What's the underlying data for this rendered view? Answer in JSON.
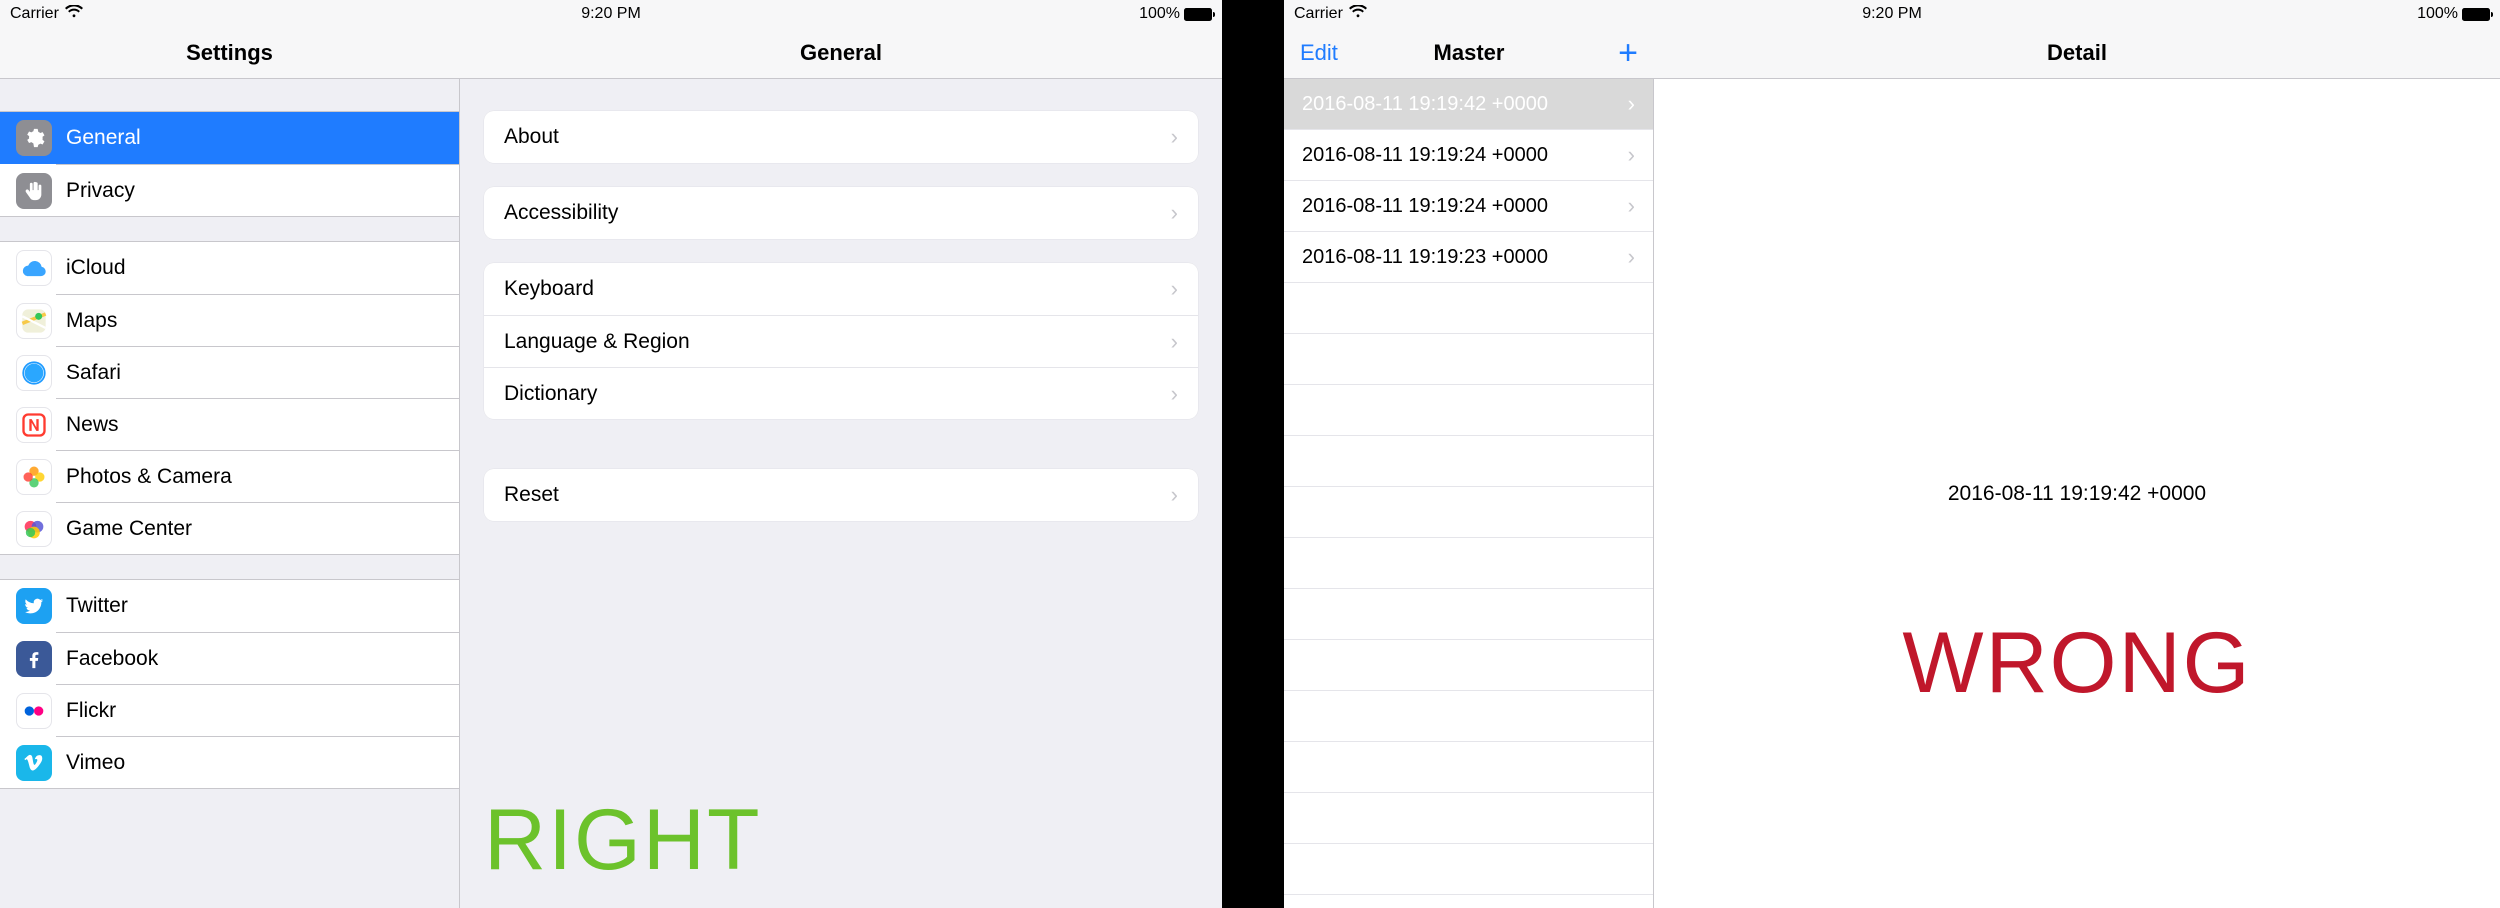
{
  "status": {
    "carrier": "Carrier",
    "time": "9:20 PM",
    "battery_pct": "100%"
  },
  "left": {
    "sidebar_title": "Settings",
    "detail_title": "General",
    "overlay": "RIGHT",
    "groups": [
      {
        "items": [
          {
            "icon": "gear-icon",
            "bg": "#8e8e93",
            "label": "General",
            "selected": true
          },
          {
            "icon": "hand-icon",
            "bg": "#8e8e93",
            "label": "Privacy"
          }
        ]
      },
      {
        "items": [
          {
            "icon": "icloud-icon",
            "bg": "#ffffff",
            "fg": "#1fa7ff",
            "label": "iCloud"
          },
          {
            "icon": "maps-icon",
            "bg": "#ffffff",
            "label": "Maps"
          },
          {
            "icon": "safari-icon",
            "bg": "#ffffff",
            "fg": "#1f7cff",
            "label": "Safari"
          },
          {
            "icon": "news-icon",
            "bg": "#ffffff",
            "fg": "#ff3b30",
            "label": "News"
          },
          {
            "icon": "photos-icon",
            "bg": "#ffffff",
            "label": "Photos & Camera"
          },
          {
            "icon": "gamecenter-icon",
            "bg": "#ffffff",
            "label": "Game Center"
          }
        ]
      },
      {
        "items": [
          {
            "icon": "twitter-icon",
            "bg": "#1da1f2",
            "label": "Twitter"
          },
          {
            "icon": "facebook-icon",
            "bg": "#3b5998",
            "label": "Facebook"
          },
          {
            "icon": "flickr-icon",
            "bg": "#ffffff",
            "label": "Flickr"
          },
          {
            "icon": "vimeo-icon",
            "bg": "#1ab7ea",
            "label": "Vimeo"
          }
        ]
      }
    ],
    "detail_groups": [
      [
        "About"
      ],
      [
        "Accessibility"
      ],
      [
        "Keyboard",
        "Language & Region",
        "Dictionary"
      ],
      [
        "Reset"
      ]
    ]
  },
  "right": {
    "edit_label": "Edit",
    "master_title": "Master",
    "detail_title": "Detail",
    "overlay": "WRONG",
    "selected_detail": "2016-08-11 19:19:42 +0000",
    "rows": [
      {
        "label": "2016-08-11 19:19:42 +0000",
        "selected": true
      },
      {
        "label": "2016-08-11 19:19:24 +0000"
      },
      {
        "label": "2016-08-11 19:19:24 +0000"
      },
      {
        "label": "2016-08-11 19:19:23 +0000"
      }
    ],
    "empty_row_count": 12
  }
}
